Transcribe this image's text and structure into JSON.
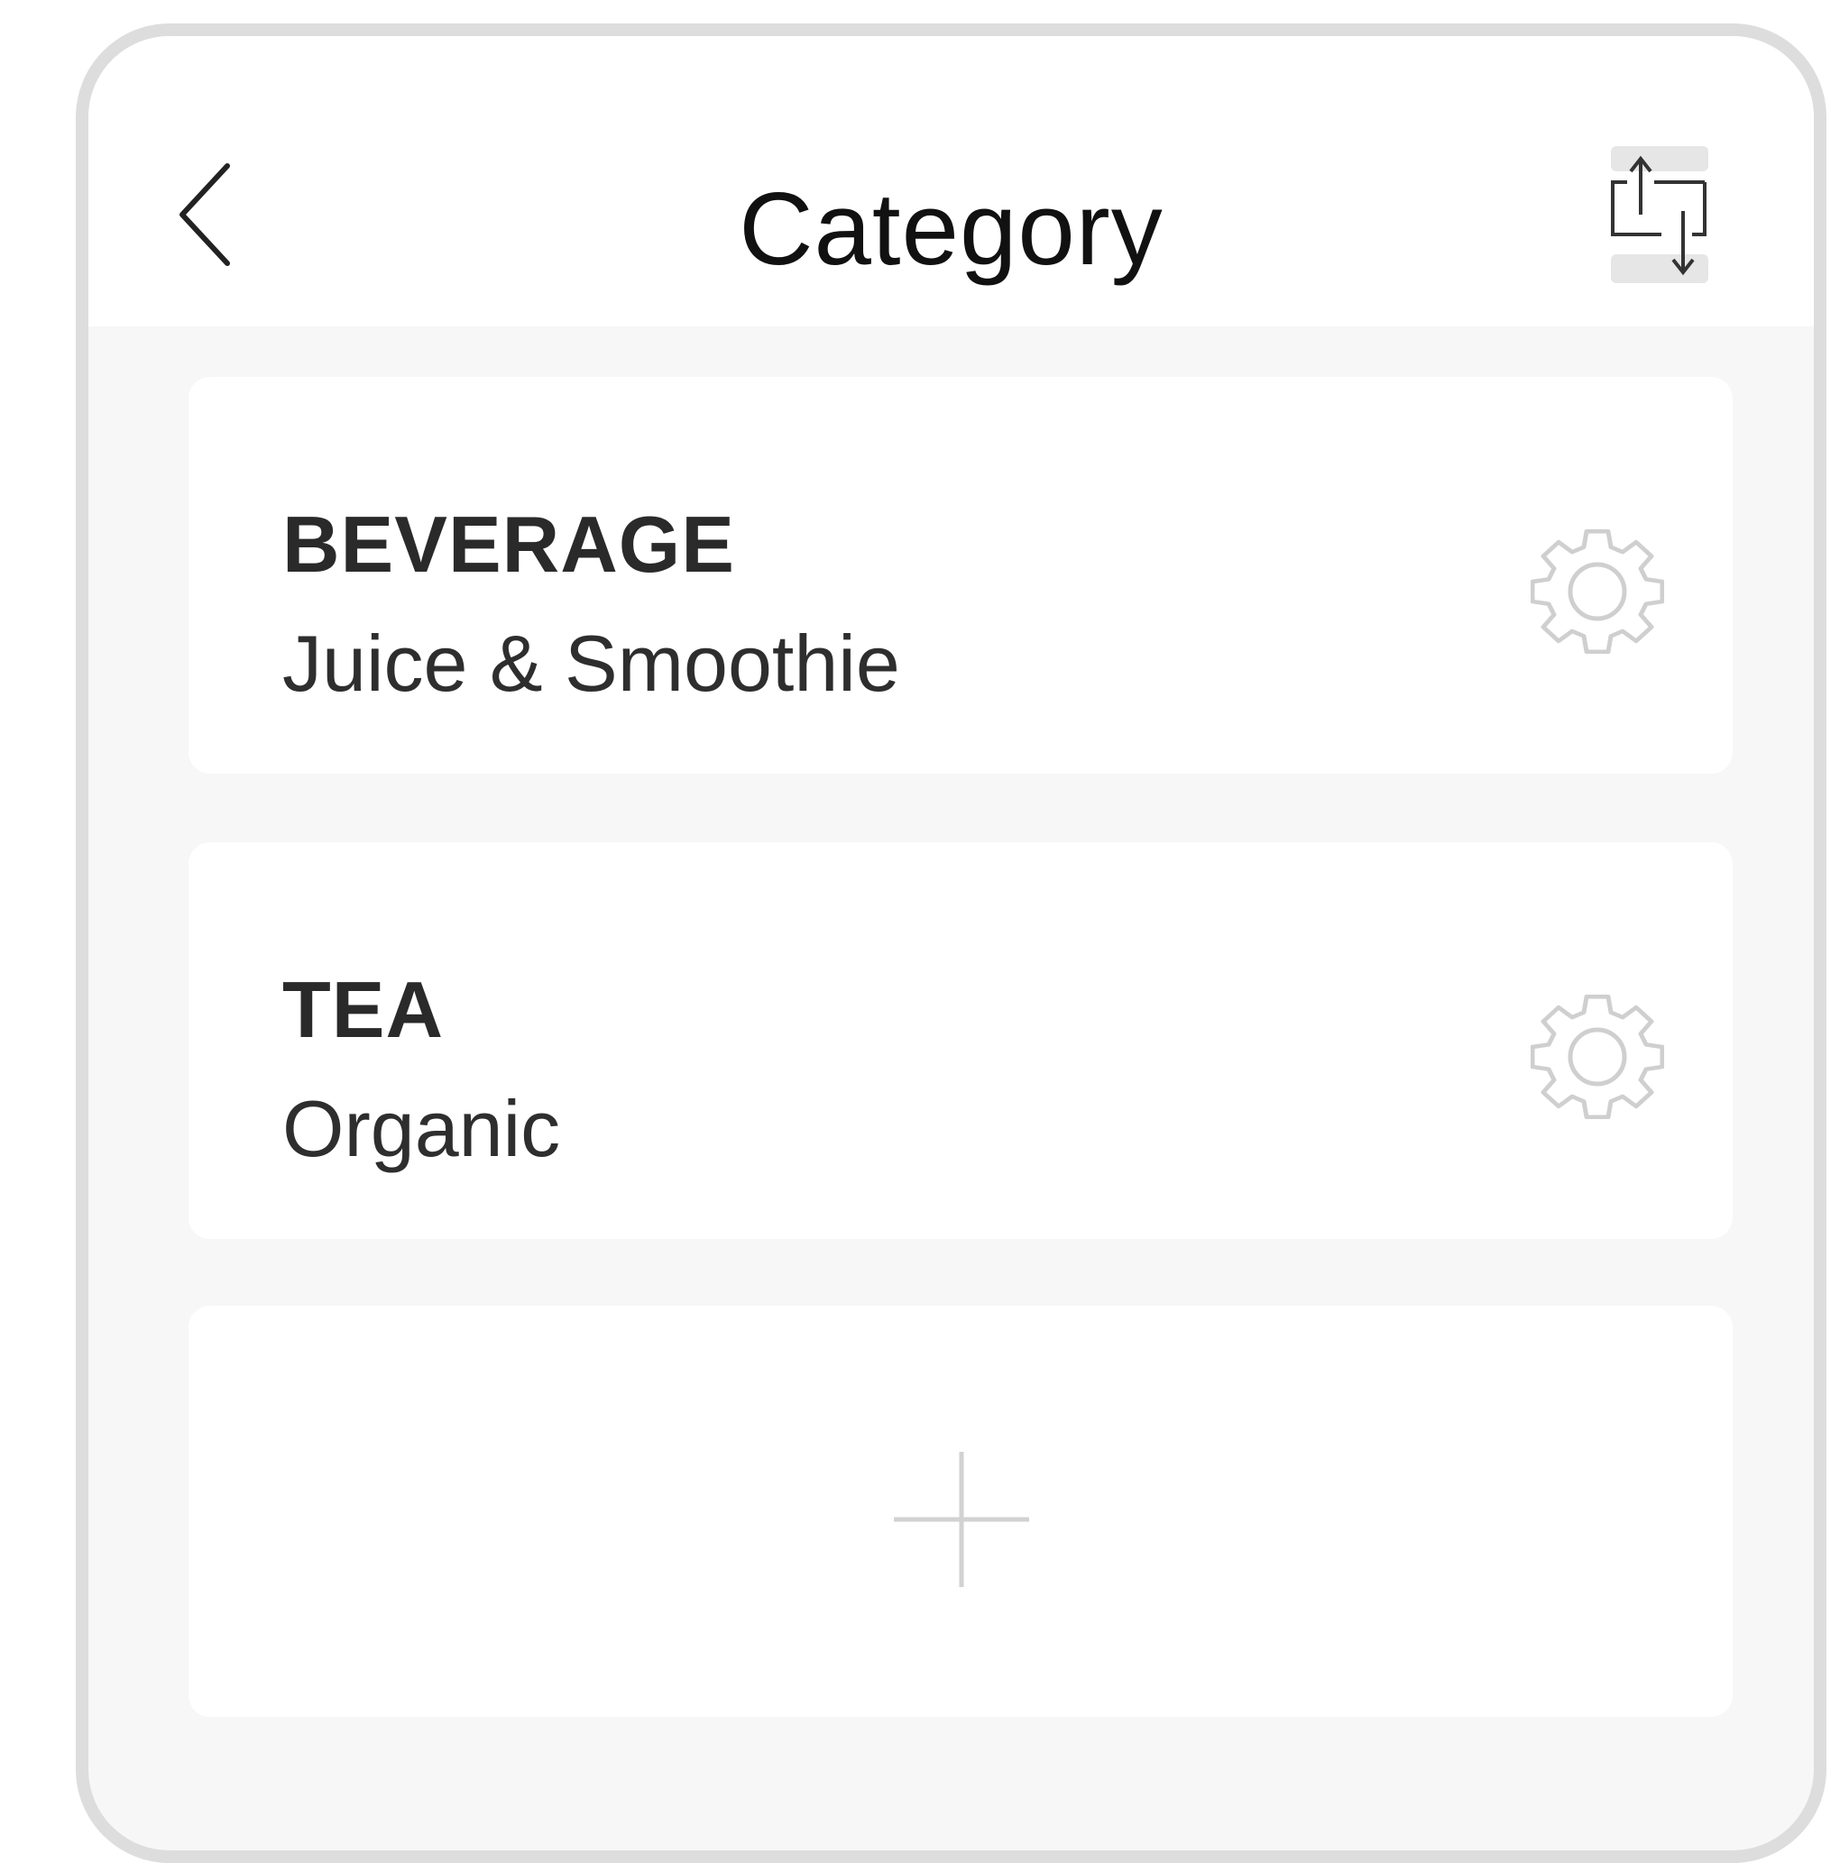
{
  "header": {
    "title": "Category",
    "back_icon": "chevron-left-icon",
    "sort_icon": "sort-transfer-icon"
  },
  "categories": [
    {
      "title": "BEVERAGE",
      "subtitle": "Juice & Smoothie",
      "settings_icon": "gear-icon"
    },
    {
      "title": "TEA",
      "subtitle": "Organic",
      "settings_icon": "gear-icon"
    }
  ],
  "add_card": {
    "icon": "plus-icon"
  },
  "colors": {
    "frame_border": "#dddddd",
    "screen_background": "#f7f7f7",
    "card_background": "#ffffff",
    "title_text": "#111111",
    "icon_light": "#cccccc"
  }
}
